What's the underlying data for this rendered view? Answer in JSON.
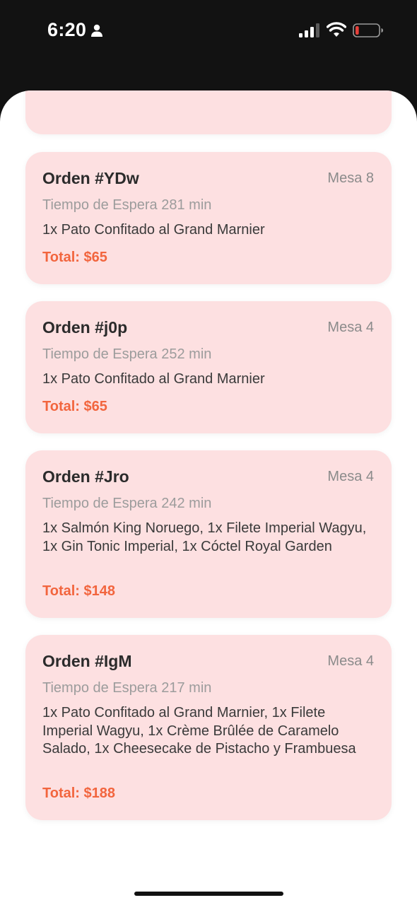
{
  "status_bar": {
    "time": "6:20",
    "icons": [
      "person-icon",
      "signal-icon",
      "wifi-icon",
      "battery-icon"
    ],
    "battery_level": 0.15,
    "battery_color": "#e5403a"
  },
  "theme": {
    "card_background": "#fde0e1",
    "total_color": "#f2653e"
  },
  "orders": [
    {
      "title": "Orden #YDw",
      "table": "Mesa 8",
      "wait": "Tiempo de Espera 281 min",
      "items": "1x Pato Confitado al Grand Marnier",
      "total": "Total: $65"
    },
    {
      "title": "Orden #j0p",
      "table": "Mesa 4",
      "wait": "Tiempo de Espera 252 min",
      "items": "1x Pato Confitado al Grand Marnier",
      "total": "Total: $65"
    },
    {
      "title": "Orden #Jro",
      "table": "Mesa 4",
      "wait": "Tiempo de Espera 242 min",
      "items": "1x Salmón King Noruego, 1x Filete Imperial Wagyu, 1x Gin Tonic Imperial, 1x Cóctel Royal Garden",
      "total": "Total: $148"
    },
    {
      "title": "Orden #IgM",
      "table": "Mesa 4",
      "wait": "Tiempo de Espera 217 min",
      "items": "1x Pato Confitado al Grand Marnier, 1x Filete Imperial Wagyu, 1x Crème Brûlée de Caramelo Salado, 1x Cheesecake de Pistacho y Frambuesa",
      "total": "Total: $188"
    }
  ]
}
